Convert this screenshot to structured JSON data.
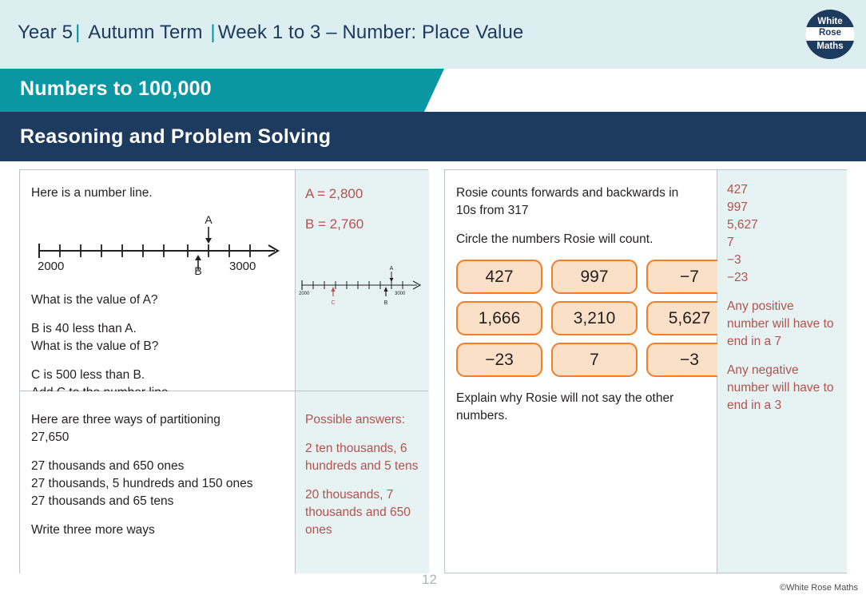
{
  "header": {
    "year": "Year 5",
    "term": "Autumn Term",
    "week": "Week 1 to 3 – Number: Place Value",
    "separator": "|",
    "logo": {
      "line1": "White",
      "line2": "Rose",
      "line3": "Maths"
    }
  },
  "banners": {
    "topic": "Numbers to 100,000",
    "section": "Reasoning and Problem Solving",
    "teal_color": "#0897a3",
    "navy_color": "#1d3a5f",
    "header_bg": "#ddeef0"
  },
  "q1": {
    "intro": "Here is a number line.",
    "number_line": {
      "start_label": "2000",
      "end_label": "3000",
      "ticks": 12,
      "marker_a": "A",
      "marker_b": "B"
    },
    "ask_a": "What is the value of A?",
    "b_clue": "B is 40 less than A.",
    "ask_b": "What is the value of B?",
    "c_clue": "C is 500 less than B.",
    "ask_c": "Add C to the number line."
  },
  "a1": {
    "value_a": "A = 2,800",
    "value_b": "B = 2,760",
    "mini_line": {
      "start_label": "2000",
      "end_label": "3000",
      "marker_a": "A",
      "marker_b": "B",
      "marker_c": "C"
    }
  },
  "q2": {
    "intro": "Here are three ways of partitioning",
    "number": "27,650",
    "ways": [
      "27 thousands and 650 ones",
      "27 thousands, 5 hundreds and 150 ones",
      "27 thousands and 65 tens"
    ],
    "task": "Write three more ways"
  },
  "a2": {
    "heading": "Possible answers:",
    "answers": [
      "2 ten thousands, 6 hundreds and 5 tens",
      "20 thousands, 7 thousands and 650 ones"
    ]
  },
  "q3": {
    "line1": "Rosie counts forwards and backwards in",
    "line2": "10s from 317",
    "instruction": "Circle the numbers Rosie will count.",
    "numbers": [
      "427",
      "997",
      "−7",
      "1,666",
      "3,210",
      "5,627",
      "−23",
      "7",
      "−3"
    ],
    "explain": "Explain why Rosie will not say the other numbers.",
    "box_fill": "#fbe0c8",
    "box_border": "#ef7f28"
  },
  "a3": {
    "circled": [
      "427",
      "997",
      "5,627",
      "7",
      "−3",
      "−23"
    ],
    "reason_positive": "Any positive number will have to end in a 7",
    "reason_negative": "Any negative number will have to end in a 3"
  },
  "footer": {
    "page_number": "12",
    "copyright": "©White Rose Maths"
  }
}
